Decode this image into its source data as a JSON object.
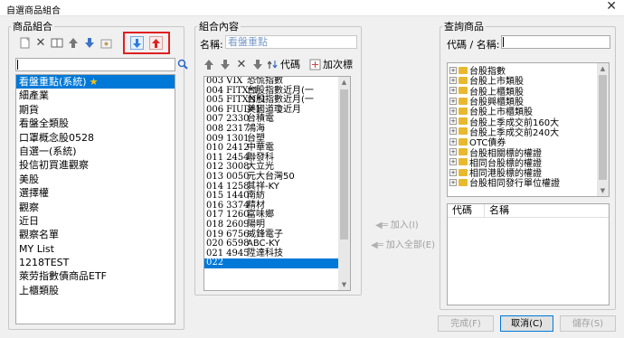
{
  "window": {
    "title": "自選商品組合",
    "close_glyph": "✕"
  },
  "left": {
    "group_title": "商品組合",
    "search_value": "",
    "groups": [
      {
        "label": "看盤重點(系統)",
        "star": "★",
        "selected": true
      },
      {
        "label": "細產業"
      },
      {
        "label": "期貨"
      },
      {
        "label": "看盤全類股"
      },
      {
        "label": "口罩概念股0528"
      },
      {
        "label": "自選一(系統)"
      },
      {
        "label": "投信初買進觀察"
      },
      {
        "label": "美股"
      },
      {
        "label": "選擇權"
      },
      {
        "label": "觀察"
      },
      {
        "label": "近日"
      },
      {
        "label": "觀察名單"
      },
      {
        "label": "MY List"
      },
      {
        "label": "1218TEST"
      },
      {
        "label": "萊劳指數債商品ETF"
      },
      {
        "label": "上櫃類股"
      }
    ]
  },
  "middle": {
    "group_title": "組合內容",
    "name_label": "名稱:",
    "name_value": "看盤重點",
    "code_button": "代碼",
    "add_next_button": "加次標",
    "symbols": [
      {
        "row": "003",
        "code": "VIX",
        "name": "恐慌指數"
      },
      {
        "row": "004",
        "code": "FITX*1",
        "name": "台股指數近月(一"
      },
      {
        "row": "005",
        "code": "FITXN*1",
        "name": "台股指數近月(一"
      },
      {
        "row": "006",
        "code": "FIUD*1",
        "name": "美國道瓊近月"
      },
      {
        "row": "007",
        "code": "2330",
        "name": "台積電"
      },
      {
        "row": "008",
        "code": "2317",
        "name": "鴻海"
      },
      {
        "row": "009",
        "code": "1301",
        "name": "台塑"
      },
      {
        "row": "010",
        "code": "2412",
        "name": "中華電"
      },
      {
        "row": "011",
        "code": "2454",
        "name": "聯發科"
      },
      {
        "row": "012",
        "code": "3008",
        "name": "大立光"
      },
      {
        "row": "013",
        "code": "0050",
        "name": "元大台灣50"
      },
      {
        "row": "014",
        "code": "1258",
        "name": "其祥-KY"
      },
      {
        "row": "015",
        "code": "1440",
        "name": "南紡"
      },
      {
        "row": "016",
        "code": "3374",
        "name": "精材"
      },
      {
        "row": "017",
        "code": "1260",
        "name": "富味鄉"
      },
      {
        "row": "018",
        "code": "2609",
        "name": "陽明"
      },
      {
        "row": "019",
        "code": "6756",
        "name": "威鋒電子"
      },
      {
        "row": "020",
        "code": "6598",
        "name": "ABC-KY"
      },
      {
        "row": "021",
        "code": "4945",
        "name": "陞達科技"
      },
      {
        "row": "022",
        "code": "",
        "name": "",
        "selected": true
      }
    ]
  },
  "add_buttons": {
    "add": "加入(I)",
    "add_all": "加入全部(E)"
  },
  "right": {
    "group_title": "查詢商品",
    "search_label": "代碼 / 名稱:",
    "search_value": "",
    "tree": [
      "台股指數",
      "台股上市類股",
      "台股上櫃類股",
      "台股興櫃類股",
      "台股上市櫃類股",
      "台股上季成交前160大",
      "台股上季成交前240大",
      "OTC債券",
      "台股相關標的權證",
      "相同台股標的權證",
      "相同港股標的權證",
      "台股相同發行單位權證"
    ],
    "result_headers": {
      "code": "代碼",
      "name": "名稱"
    }
  },
  "footer": {
    "finish": "完成(F)",
    "cancel": "取消(C)",
    "save": "儲存(S)"
  },
  "colors": {
    "selection": "#0078d7",
    "highlight_box": "#e02020",
    "folder": "#e8b830"
  }
}
